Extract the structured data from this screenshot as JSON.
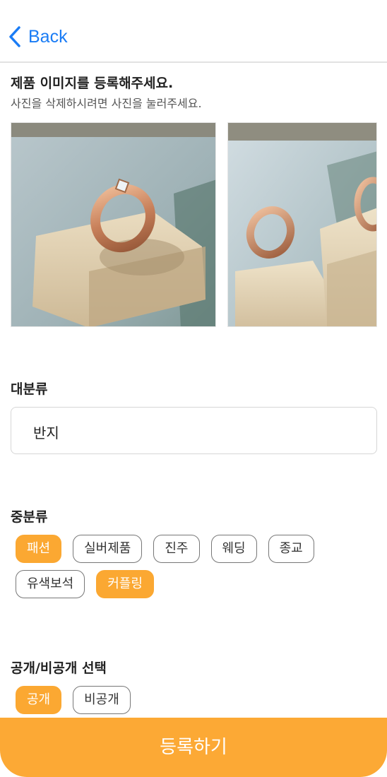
{
  "nav": {
    "back_label": "Back",
    "back_icon": "chevron-left-icon"
  },
  "images": {
    "title": "제품 이미지를 등록해주세요.",
    "subtitle": "사진을 삭제하시려면 사진을 눌러주세요."
  },
  "category": {
    "label": "대분류",
    "value": "반지"
  },
  "subcategory": {
    "label": "중분류",
    "row1": [
      {
        "label": "패션",
        "selected": true
      },
      {
        "label": "실버제품",
        "selected": false
      },
      {
        "label": "진주",
        "selected": false
      },
      {
        "label": "웨딩",
        "selected": false
      },
      {
        "label": "종교",
        "selected": false
      }
    ],
    "row2": [
      {
        "label": "유색보석",
        "selected": false
      },
      {
        "label": "커플링",
        "selected": true
      }
    ]
  },
  "visibility": {
    "label": "공개/비공개 선택",
    "options": [
      {
        "label": "공개",
        "selected": true
      },
      {
        "label": "비공개",
        "selected": false
      }
    ]
  },
  "submit_label": "등록하기",
  "colors": {
    "accent": "#fba832",
    "link": "#1a7cf5",
    "border": "#d6d6d6"
  }
}
